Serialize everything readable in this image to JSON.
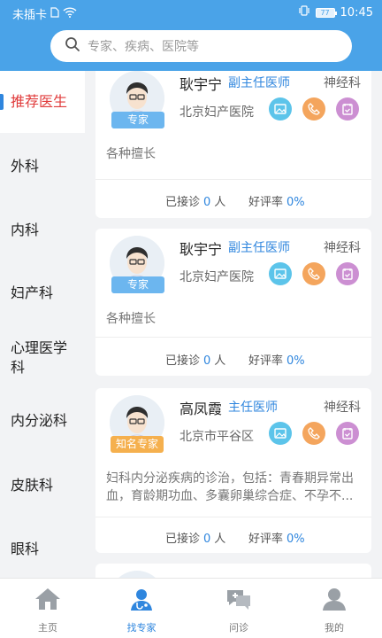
{
  "status": {
    "carrier": "未插卡",
    "battery": "77",
    "time": "10:45"
  },
  "search": {
    "placeholder": "专家、疾病、医院等"
  },
  "sidebar": {
    "items": [
      {
        "label": "推荐医生",
        "active": true
      },
      {
        "label": "外科"
      },
      {
        "label": "内科"
      },
      {
        "label": "妇产科"
      },
      {
        "label": "心理医学科"
      },
      {
        "label": "内分泌科"
      },
      {
        "label": "皮肤科"
      },
      {
        "label": "眼科"
      }
    ]
  },
  "doctors": [
    {
      "name": "耿宇宁",
      "title": "副主任医师",
      "dept": "神经科",
      "hospital": "北京妇产医院",
      "badge": "专家",
      "skill": "各种擅长",
      "consult_label": "已接诊",
      "consult_count": "0",
      "consult_unit": "人",
      "rating_label": "好评率",
      "rating": "0%"
    },
    {
      "name": "耿宇宁",
      "title": "副主任医师",
      "dept": "神经科",
      "hospital": "北京妇产医院",
      "badge": "专家",
      "skill": "各种擅长",
      "consult_label": "已接诊",
      "consult_count": "0",
      "consult_unit": "人",
      "rating_label": "好评率",
      "rating": "0%"
    },
    {
      "name": "高凤霞",
      "title": "主任医师",
      "dept": "神经科",
      "hospital": "北京市平谷区",
      "badge": "知名专家",
      "skill": "妇科内分泌疾病的诊治，包括：青春期异常出血，育龄期功血、多囊卵巢综合症、不孕不...",
      "consult_label": "已接诊",
      "consult_count": "0",
      "consult_unit": "人",
      "rating_label": "好评率",
      "rating": "0%"
    }
  ],
  "tabbar": {
    "items": [
      {
        "label": "主页",
        "icon": "home-icon"
      },
      {
        "label": "找专家",
        "icon": "doctor-icon",
        "active": true
      },
      {
        "label": "问诊",
        "icon": "chat-icon"
      },
      {
        "label": "我的",
        "icon": "user-icon"
      }
    ]
  },
  "colors": {
    "header": "#4aa3e8",
    "accent": "#2f86de",
    "active_side": "#e03b3b"
  }
}
